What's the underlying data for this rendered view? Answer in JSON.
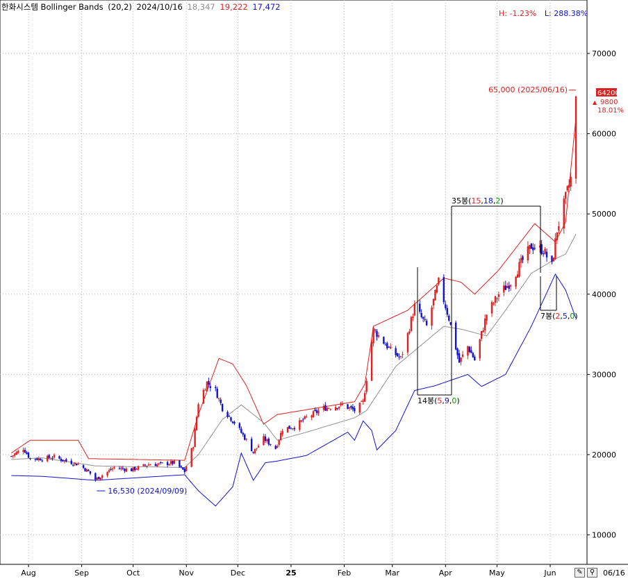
{
  "title": {
    "name": "한화시스템 Bollinger Bands",
    "params": "(20,2)",
    "date": "2024/10/16",
    "mid": "18,347",
    "upper": "19,222",
    "lower": "17,472"
  },
  "summary": {
    "high": "H: -1.23%",
    "low": "L: 288.38%"
  },
  "last_price": {
    "value": "64200",
    "change": "9800",
    "change_pct": "18.01%"
  },
  "annotations": {
    "high_mark": "65,000 (2025/06/16)",
    "low_mark": "16,530 (2024/09/09)",
    "range_35_count": "35봉",
    "range_35_a": "15",
    "range_35_b": "18",
    "range_35_c": "2",
    "range_14_count": "14봉",
    "range_14_a": "5",
    "range_14_b": "9",
    "range_14_c": "0",
    "range_7_count": "7봉",
    "range_7_a": "2",
    "range_7_b": "5",
    "range_7_c": "0"
  },
  "footer": {
    "date": "06/16"
  },
  "colors": {
    "up": "#e02020",
    "down": "#1010d0",
    "upper": "#e02020",
    "lower": "#1010d0",
    "mid": "#909090",
    "grid": "#b0b0b0"
  },
  "chart_data": {
    "type": "candlestick-with-bollinger-bands",
    "y_ticks": [
      10000,
      20000,
      30000,
      40000,
      50000,
      60000,
      70000
    ],
    "y_tick_labels": [
      "10000",
      "20000",
      "30000",
      "40000",
      "50000",
      "60000",
      "70000"
    ],
    "ylim": [
      3600,
      75400
    ],
    "x_labels": [
      "Aug",
      "Sep",
      "Oct",
      "Nov",
      "Dec",
      "25",
      "Feb",
      "Mar",
      "Apr",
      "May",
      "Jun"
    ],
    "close_anchors": [
      [
        "2024-07-22",
        19800
      ],
      [
        "2024-07-29",
        20800
      ],
      [
        "2024-08-02",
        19500
      ],
      [
        "2024-08-09",
        19500
      ],
      [
        "2024-08-16",
        19700
      ],
      [
        "2024-08-23",
        19200
      ],
      [
        "2024-08-30",
        18800
      ],
      [
        "2024-09-05",
        17900
      ],
      [
        "2024-09-09",
        16900
      ],
      [
        "2024-09-20",
        18400
      ],
      [
        "2024-09-30",
        18100
      ],
      [
        "2024-10-10",
        18800
      ],
      [
        "2024-10-16",
        18800
      ],
      [
        "2024-10-25",
        19000
      ],
      [
        "2024-10-31",
        17900
      ],
      [
        "2024-11-05",
        21200
      ],
      [
        "2024-11-08",
        26500
      ],
      [
        "2024-11-13",
        29000
      ],
      [
        "2024-11-18",
        28000
      ],
      [
        "2024-11-22",
        25800
      ],
      [
        "2024-11-29",
        24000
      ],
      [
        "2024-12-06",
        21800
      ],
      [
        "2024-12-10",
        20300
      ],
      [
        "2024-12-16",
        22000
      ],
      [
        "2024-12-23",
        20800
      ],
      [
        "2024-12-27",
        23200
      ],
      [
        "2025-01-03",
        23500
      ],
      [
        "2025-01-10",
        24600
      ],
      [
        "2025-01-20",
        25800
      ],
      [
        "2025-01-31",
        26200
      ],
      [
        "2025-02-07",
        25500
      ],
      [
        "2025-02-12",
        26500
      ],
      [
        "2025-02-18",
        35600
      ],
      [
        "2025-02-28",
        33000
      ],
      [
        "2025-03-06",
        32000
      ],
      [
        "2025-03-10",
        35000
      ],
      [
        "2025-03-14",
        38500
      ],
      [
        "2025-03-21",
        36000
      ],
      [
        "2025-03-28",
        41500
      ],
      [
        "2025-04-03",
        37000
      ],
      [
        "2025-04-09",
        31500
      ],
      [
        "2025-04-14",
        33500
      ],
      [
        "2025-04-18",
        31800
      ],
      [
        "2025-04-25",
        37500
      ],
      [
        "2025-05-02",
        40000
      ],
      [
        "2025-05-09",
        41500
      ],
      [
        "2025-05-14",
        43500
      ],
      [
        "2025-05-21",
        46000
      ],
      [
        "2025-05-28",
        45500
      ],
      [
        "2025-06-02",
        43500
      ],
      [
        "2025-06-05",
        48000
      ],
      [
        "2025-06-10",
        52000
      ],
      [
        "2025-06-13",
        54400
      ],
      [
        "2025-06-16",
        64200
      ]
    ],
    "bollinger_upper": [
      [
        "2024-07-22",
        20200
      ],
      [
        "2024-08-02",
        21800
      ],
      [
        "2024-08-30",
        21800
      ],
      [
        "2024-09-05",
        19500
      ],
      [
        "2024-10-31",
        19300
      ],
      [
        "2024-11-08",
        25000
      ],
      [
        "2024-11-20",
        32000
      ],
      [
        "2024-11-28",
        31300
      ],
      [
        "2024-12-06",
        28600
      ],
      [
        "2024-12-16",
        23800
      ],
      [
        "2024-12-24",
        25000
      ],
      [
        "2025-01-10",
        25600
      ],
      [
        "2025-02-07",
        26600
      ],
      [
        "2025-02-13",
        28800
      ],
      [
        "2025-02-18",
        36000
      ],
      [
        "2025-03-10",
        38000
      ],
      [
        "2025-03-31",
        42000
      ],
      [
        "2025-04-10",
        41500
      ],
      [
        "2025-04-18",
        40000
      ],
      [
        "2025-05-02",
        43000
      ],
      [
        "2025-05-23",
        48800
      ],
      [
        "2025-06-04",
        46500
      ],
      [
        "2025-06-10",
        49000
      ],
      [
        "2025-06-16",
        62000
      ]
    ],
    "bollinger_mid": [
      [
        "2024-07-22",
        19400
      ],
      [
        "2024-08-09",
        19600
      ],
      [
        "2024-09-09",
        18600
      ],
      [
        "2024-10-31",
        18400
      ],
      [
        "2024-11-08",
        20000
      ],
      [
        "2024-11-22",
        24400
      ],
      [
        "2024-12-03",
        26200
      ],
      [
        "2024-12-16",
        24000
      ],
      [
        "2024-12-24",
        21800
      ],
      [
        "2025-01-10",
        22800
      ],
      [
        "2025-02-07",
        24600
      ],
      [
        "2025-02-14",
        25500
      ],
      [
        "2025-03-03",
        31000
      ],
      [
        "2025-03-31",
        36000
      ],
      [
        "2025-04-11",
        35600
      ],
      [
        "2025-04-25",
        34800
      ],
      [
        "2025-05-06",
        38000
      ],
      [
        "2025-05-21",
        42600
      ],
      [
        "2025-06-05",
        44500
      ],
      [
        "2025-06-10",
        45000
      ],
      [
        "2025-06-16",
        47500
      ]
    ],
    "bollinger_lower": [
      [
        "2024-07-22",
        17400
      ],
      [
        "2024-08-09",
        17300
      ],
      [
        "2024-09-09",
        16800
      ],
      [
        "2024-10-31",
        17500
      ],
      [
        "2024-11-08",
        15500
      ],
      [
        "2024-11-18",
        13600
      ],
      [
        "2024-11-28",
        16000
      ],
      [
        "2024-12-03",
        20200
      ],
      [
        "2024-12-10",
        16800
      ],
      [
        "2024-12-17",
        19000
      ],
      [
        "2024-12-24",
        19200
      ],
      [
        "2025-01-10",
        19900
      ],
      [
        "2025-02-03",
        22800
      ],
      [
        "2025-02-07",
        21800
      ],
      [
        "2025-02-12",
        24200
      ],
      [
        "2025-02-17",
        23000
      ],
      [
        "2025-02-20",
        20600
      ],
      [
        "2025-03-03",
        23000
      ],
      [
        "2025-03-14",
        28000
      ],
      [
        "2025-03-26",
        28600
      ],
      [
        "2025-04-14",
        30000
      ],
      [
        "2025-04-22",
        28500
      ],
      [
        "2025-05-06",
        30000
      ],
      [
        "2025-05-21",
        36000
      ],
      [
        "2025-06-04",
        42500
      ],
      [
        "2025-06-10",
        40500
      ],
      [
        "2025-06-16",
        37000
      ]
    ]
  }
}
